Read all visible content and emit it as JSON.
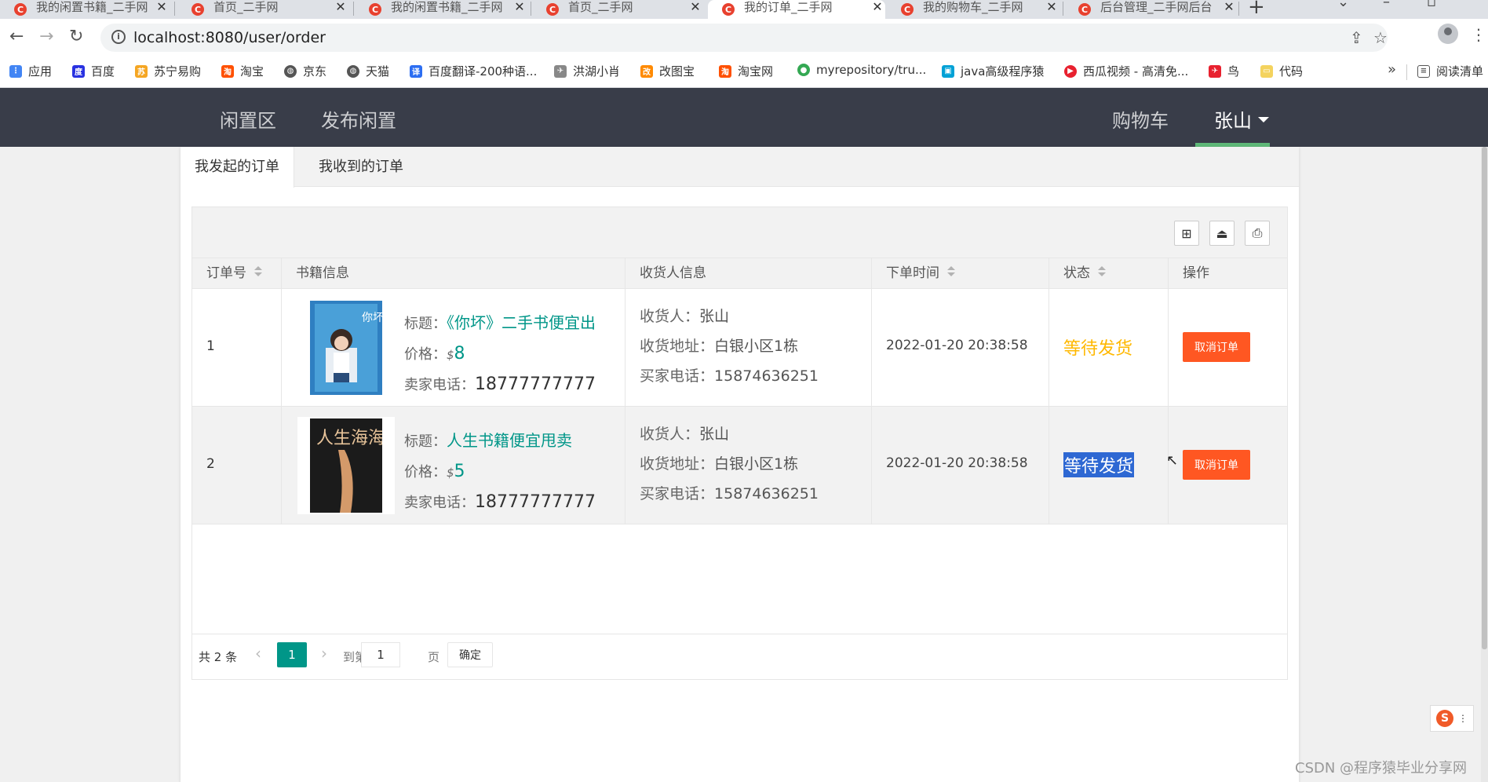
{
  "browser": {
    "tabs": [
      {
        "title": "我的闲置书籍_二手网",
        "active": false
      },
      {
        "title": "首页_二手网",
        "active": false
      },
      {
        "title": "我的闲置书籍_二手网",
        "active": false
      },
      {
        "title": "首页_二手网",
        "active": false
      },
      {
        "title": "我的订单_二手网",
        "active": true
      },
      {
        "title": "我的购物车_二手网",
        "active": false
      },
      {
        "title": "后台管理_二手网后台",
        "active": false
      }
    ],
    "tab_close_glyph": "✕",
    "new_tab_glyph": "+",
    "url": "localhost:8080/user/order",
    "bookmarks": [
      {
        "label": "应用",
        "icon": "apps-grid-icon",
        "color": "#4285f4"
      },
      {
        "label": "百度",
        "icon": "baidu-paw-icon",
        "color": "#2932e1"
      },
      {
        "label": "苏宁易购",
        "icon": "suning-icon",
        "color": "#f5a623"
      },
      {
        "label": "淘宝",
        "icon": "taobao-icon",
        "color": "#ff5000"
      },
      {
        "label": "京东",
        "icon": "globe-icon",
        "color": "#555555"
      },
      {
        "label": "天猫",
        "icon": "globe-icon",
        "color": "#555555"
      },
      {
        "label": "百度翻译-200种语...",
        "icon": "translate-icon",
        "color": "#2c6ef2"
      },
      {
        "label": "洪湖小肖",
        "icon": "bird-icon",
        "color": "#888888"
      },
      {
        "label": "改图宝",
        "icon": "gaitubao-icon",
        "color": "#ff8a00"
      },
      {
        "label": "淘宝网",
        "icon": "taobao-icon",
        "color": "#ff5000"
      },
      {
        "label": "myrepository/tru...",
        "icon": "chrome-icon",
        "color": "#34a853"
      },
      {
        "label": "java高级程序猿",
        "icon": "bilibili-icon",
        "color": "#00a1d6"
      },
      {
        "label": "西瓜视频 - 高清免...",
        "icon": "xigua-icon",
        "color": "#e8212f"
      },
      {
        "label": "鸟",
        "icon": "bird-red-icon",
        "color": "#e8212f"
      },
      {
        "label": "代码",
        "icon": "folder-icon",
        "color": "#f4d35e"
      }
    ],
    "bookmarks_more": "»",
    "reading_list": "阅读清单"
  },
  "header": {
    "nav": [
      "闲置区",
      "发布闲置"
    ],
    "cart": "购物车",
    "user": "张山"
  },
  "subtabs": [
    "我发起的订单",
    "我收到的订单"
  ],
  "table": {
    "columns": [
      "订单号",
      "书籍信息",
      "收货人信息",
      "下单时间",
      "状态",
      "操作"
    ],
    "rows": [
      {
        "order_no": "1",
        "title_label": "标题：",
        "title": "《你坏》二手书便宜出",
        "price_label": "价格：",
        "currency": "$",
        "price": "8",
        "seller_phone_label": "卖家电话：",
        "seller_phone": "18777777777",
        "receiver_label": "收货人：",
        "receiver": "张山",
        "address_label": "收货地址：",
        "address": "白银小区1栋",
        "buyer_phone_label": "买家电话：",
        "buyer_phone": "15874636251",
        "time": "2022-01-20 20:38:58",
        "status": "等待发货",
        "action": "取消订单",
        "cover_text": "你坏"
      },
      {
        "order_no": "2",
        "title_label": "标题：",
        "title": "人生书籍便宜甩卖",
        "price_label": "价格：",
        "currency": "$",
        "price": "5",
        "seller_phone_label": "卖家电话：",
        "seller_phone": "18777777777",
        "receiver_label": "收货人：",
        "receiver": "张山",
        "address_label": "收货地址：",
        "address": "白银小区1栋",
        "buyer_phone_label": "买家电话：",
        "buyer_phone": "15874636251",
        "time": "2022-01-20 20:38:58",
        "status": "等待发货",
        "action": "取消订单",
        "cover_text": "人生海海"
      }
    ]
  },
  "pager": {
    "total": "共 2 条",
    "current": "1",
    "goto_label": "到第",
    "page_input": "1",
    "page_unit": "页",
    "confirm": "确定"
  },
  "watermark": "CSDN @程序猿毕业分享网",
  "colors": {
    "header_bg": "#393d49",
    "accent_green": "#5fb878",
    "link_teal": "#009688",
    "status_orange": "#ffb800",
    "cancel_red": "#ff5722"
  }
}
